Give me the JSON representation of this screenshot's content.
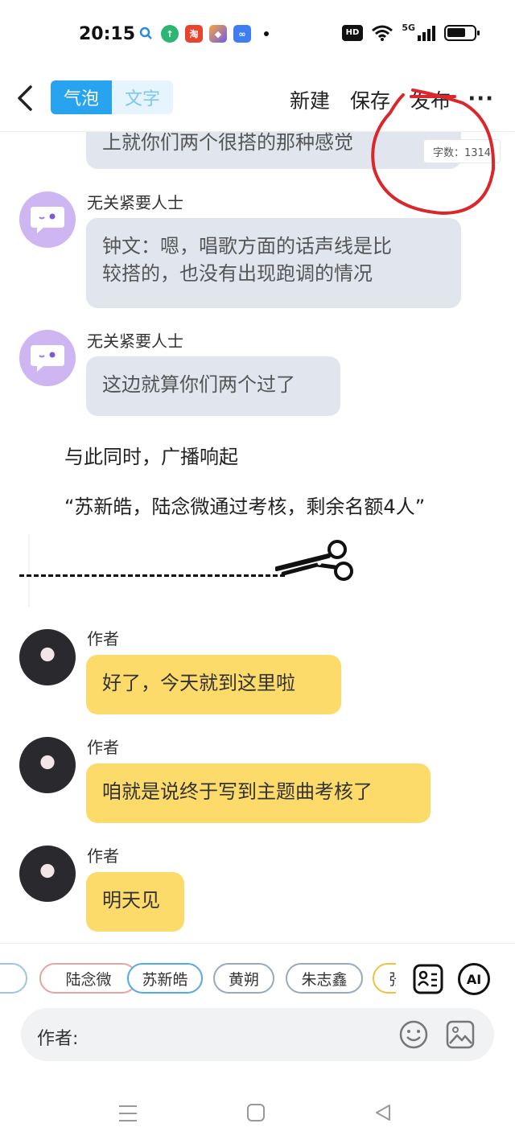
{
  "status_bar": {
    "time": "20:15",
    "network": "5G",
    "hd": "HD",
    "icons": [
      "search-icon",
      "upload-icon",
      "app-icon-red",
      "app-icon-orange",
      "infinity-icon",
      "wifi-icon",
      "signal-icon",
      "battery-icon"
    ]
  },
  "header": {
    "tab_bubble": "气泡",
    "tab_text": "文字",
    "new_label": "新建",
    "save_label": "保存",
    "publish_label": "发布",
    "more_label": "···",
    "word_count": "字数：1314"
  },
  "messages": {
    "partial_text": "上就你们两个很搭的那种感觉",
    "m1": {
      "name": "无关紧要人士",
      "text_line1": "钟文：嗯，唱歌方面的话声线是比",
      "text_line2": "较搭的，也没有出现跑调的情况"
    },
    "m2": {
      "name": "无关紧要人士",
      "text": "这边就算你们两个过了"
    },
    "narration1": "与此同时，广播响起",
    "narration2": "“苏新皓，陆念微通过考核，剩余名额4人”",
    "m3": {
      "name": "作者",
      "text": "好了，今天就到这里啦"
    },
    "m4": {
      "name": "作者",
      "text": "咱就是说终于写到主题曲考核了"
    },
    "m5": {
      "name": "作者",
      "text": "明天见"
    }
  },
  "bottom": {
    "chips": [
      "陆念微",
      "苏新皓",
      "黄朔",
      "朱志鑫",
      "张"
    ],
    "ai_label": "AI",
    "input_label": "作者:"
  },
  "colors": {
    "accent": "#27a3f0",
    "bubble_gray": "#e1e6ee",
    "bubble_yellow": "#fddb6b",
    "annotation_red": "#d9272c"
  }
}
